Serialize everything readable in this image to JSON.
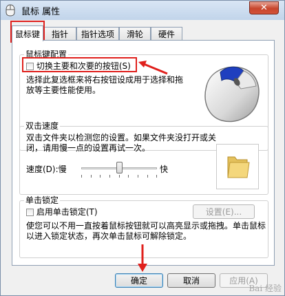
{
  "window": {
    "title": "鼠标 属性",
    "close_label": "✕"
  },
  "tabs": [
    {
      "label": "鼠标键",
      "active": true
    },
    {
      "label": "指针",
      "active": false
    },
    {
      "label": "指针选项",
      "active": false
    },
    {
      "label": "滑轮",
      "active": false
    },
    {
      "label": "硬件",
      "active": false
    }
  ],
  "button_config": {
    "title": "鼠标键配置",
    "switch_label": "切换主要和次要的按钮(S)",
    "switch_checked": false,
    "description": "选择此复选框来将右按钮设成用于选择和拖放等主要性能使用。"
  },
  "double_click": {
    "title": "双击速度",
    "description": "双击文件夹以检测您的设置。如果文件夹没打开或关闭，请用慢一点的设置再试一次。",
    "speed_label": "速度(D):慢",
    "fast_label": "快",
    "speed_level": 0.5
  },
  "click_lock": {
    "title": "单击锁定",
    "enable_label": "启用单击锁定(T)",
    "enable_checked": false,
    "settings_button": "设置(E)...",
    "description": "使您可以不用一直按着鼠标按钮就可以高亮显示或拖拽。单击鼠标以进入锁定状态，再次单击鼠标可解除锁定。"
  },
  "footer": {
    "ok": "确定",
    "cancel": "取消",
    "apply": "应用(A)"
  },
  "watermark": "Bai 经验",
  "colors": {
    "annotation_red": "#e0201c",
    "tab_border": "#8e9eb2"
  }
}
